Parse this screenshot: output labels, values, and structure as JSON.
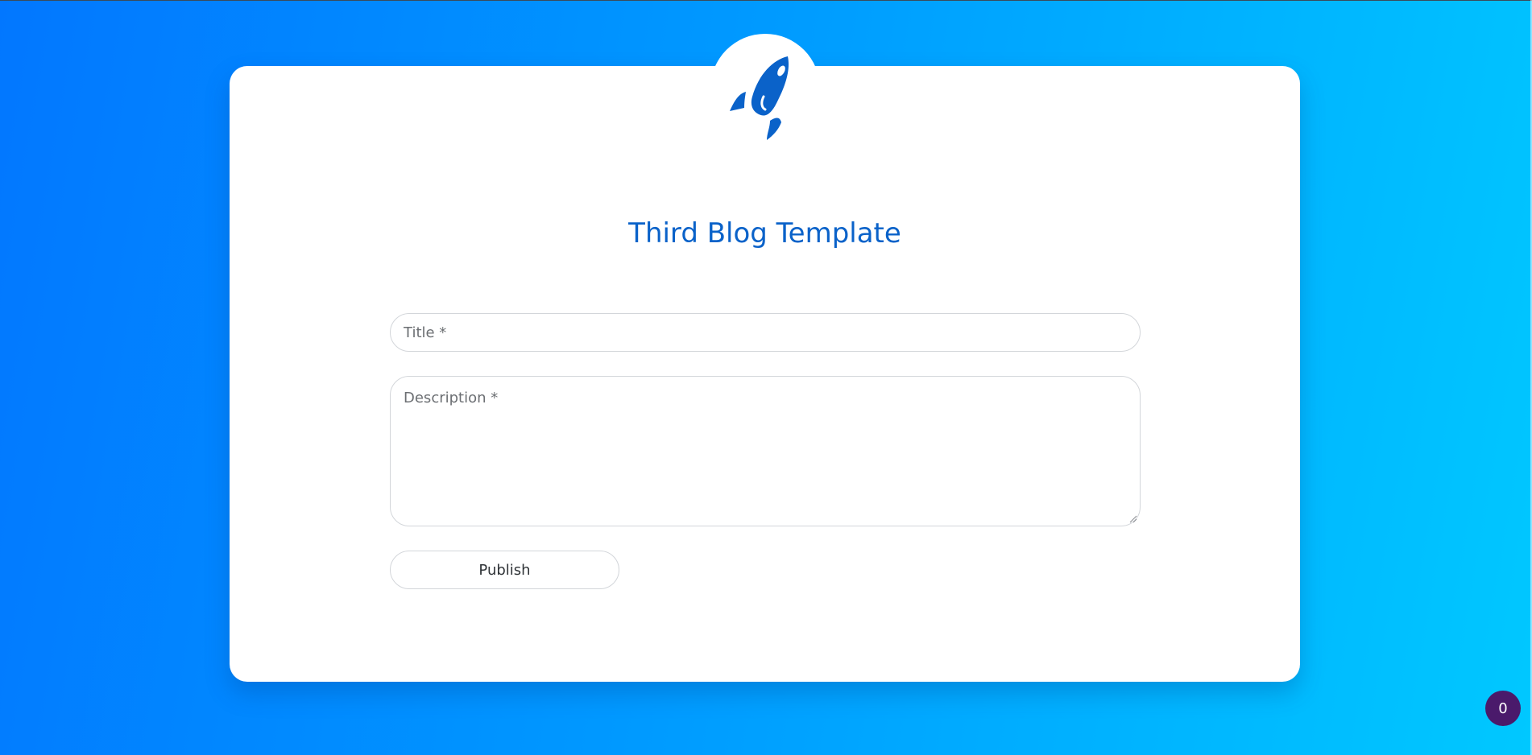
{
  "page": {
    "title": "Third Blog Template",
    "logo_icon": "rocket-icon",
    "brand_color": "#0a62c9"
  },
  "form": {
    "title_placeholder": "Title *",
    "title_value": "",
    "description_placeholder": "Description *",
    "description_value": "",
    "publish_label": "Publish"
  },
  "badge": {
    "count": "0",
    "color": "#4a1a6b"
  },
  "colors": {
    "gradient_start": "#0277ff",
    "gradient_end": "#00c8ff"
  }
}
